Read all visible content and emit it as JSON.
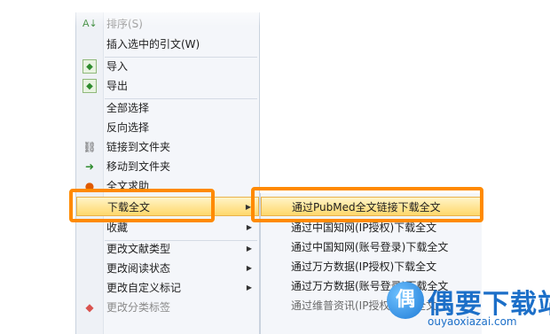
{
  "context_menu": {
    "items": [
      {
        "label": "排序(S)",
        "icon": "sort-icon",
        "disabled": true
      },
      {
        "label": "插入选中的引文(W)",
        "icon": "",
        "disabled": false
      },
      {
        "label": "导入",
        "icon": "import-icon",
        "disabled": false
      },
      {
        "label": "导出",
        "icon": "export-icon",
        "disabled": false
      },
      {
        "label": "全部选择",
        "icon": "",
        "disabled": false
      },
      {
        "label": "反向选择",
        "icon": "",
        "disabled": false
      },
      {
        "label": "链接到文件夹",
        "icon": "link-icon",
        "disabled": false
      },
      {
        "label": "移动到文件夹",
        "icon": "move-icon",
        "disabled": false
      },
      {
        "label": "全文求助",
        "icon": "help-icon",
        "disabled": false
      },
      {
        "label": "下载全文",
        "icon": "",
        "disabled": false,
        "submenu": true,
        "highlighted": true
      },
      {
        "label": "收藏",
        "icon": "",
        "disabled": false,
        "submenu": true
      },
      {
        "label": "更改文献类型",
        "icon": "",
        "disabled": false,
        "submenu": true
      },
      {
        "label": "更改阅读状态",
        "icon": "",
        "disabled": false,
        "submenu": true
      },
      {
        "label": "更改自定义标记",
        "icon": "",
        "disabled": false,
        "submenu": true
      },
      {
        "label": "更改分类标签",
        "icon": "tag-icon",
        "disabled": false
      }
    ]
  },
  "submenu": {
    "items": [
      {
        "label": "通过PubMed全文链接下载全文",
        "highlighted": true
      },
      {
        "label": "通过中国知网(IP授权)下载全文"
      },
      {
        "label": "通过中国知网(账号登录)下载全文"
      },
      {
        "label": "通过万方数据(IP授权)下载全文"
      },
      {
        "label": "通过万方数据(账号登录)下载全文"
      },
      {
        "label": "通过维普资讯(IP授权)下载全文"
      }
    ]
  },
  "watermark": {
    "name": "偶要下载站",
    "url": "ouyaoxiazai.com"
  },
  "colors": {
    "callout": "#ff8a00",
    "highlight": "#ffd86b",
    "menu_bg": "#f4f6fa"
  }
}
